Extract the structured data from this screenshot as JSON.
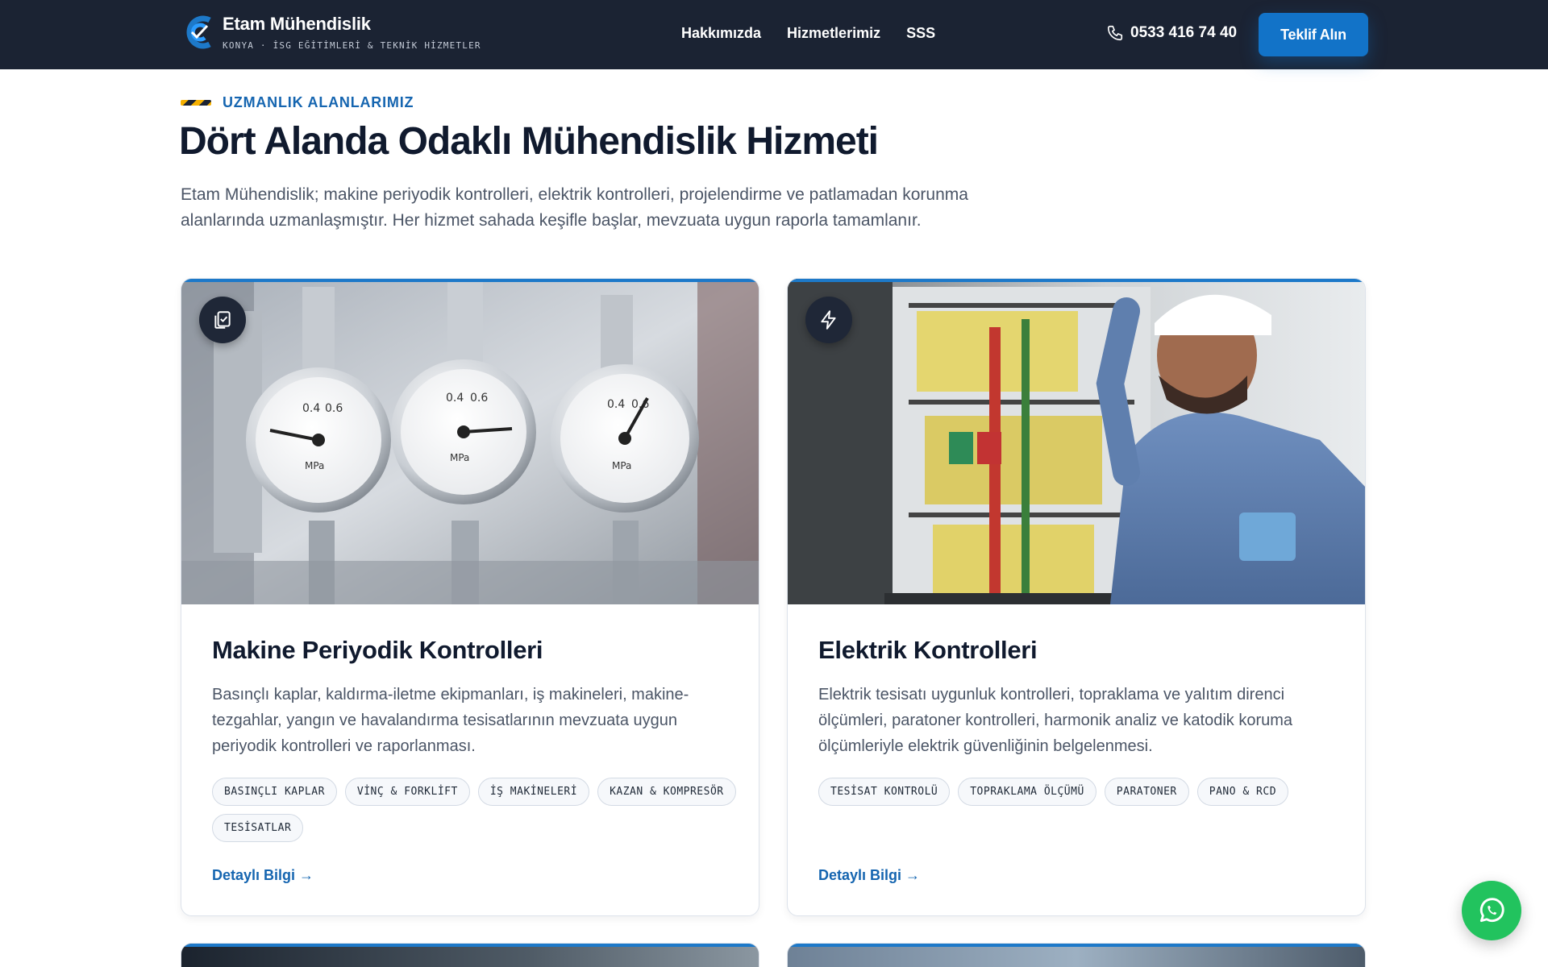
{
  "header": {
    "brand_name": "Etam Mühendislik",
    "brand_sub": "KONYA · İSG EĞİTİMLERİ & TEKNİK HİZMETLER",
    "nav": [
      "Hakkımızda",
      "Hizmetlerimiz",
      "SSS"
    ],
    "phone": "0533 416 74 40",
    "cta": "Teklif Alın"
  },
  "section": {
    "eyebrow": "UZMANLIK ALANLARIMIZ",
    "title": "Dört Alanda Odaklı Mühendislik Hizmeti",
    "lead": "Etam Mühendislik; makine periyodik kontrolleri, elektrik kontrolleri, projelendirme ve patlamadan korunma alanlarında uzmanlaşmıştır. Her hizmet sahada keşifle başlar, mevzuata uygun raporla tamamlanır."
  },
  "cards": [
    {
      "icon": "clipboard-check-icon",
      "title": "Makine Periyodik Kontrolleri",
      "desc": "Basınçlı kaplar, kaldırma-iletme ekipmanları, iş makineleri, makine-tezgahlar, yangın ve havalandırma tesisatlarının mevzuata uygun periyodik kontrolleri ve raporlanması.",
      "tags": [
        "BASINÇLI KAPLAR",
        "VİNÇ & FORKLİFT",
        "İŞ MAKİNELERİ",
        "KAZAN & KOMPRESÖR",
        "TESİSATLAR"
      ],
      "link": "Detaylı Bilgi →"
    },
    {
      "icon": "lightning-icon",
      "title": "Elektrik Kontrolleri",
      "desc": "Elektrik tesisatı uygunluk kontrolleri, topraklama ve yalıtım direnci ölçümleri, paratoner kontrolleri, harmonik analiz ve katodik koruma ölçümleriyle elektrik güvenliğinin belgelenmesi.",
      "tags": [
        "TESİSAT KONTROLÜ",
        "TOPRAKLAMA ÖLÇÜMÜ",
        "PARATONER",
        "PANO & RCD"
      ],
      "link": "Detaylı Bilgi →"
    }
  ],
  "colors": {
    "header_bg": "#1b2333",
    "accent": "#1273c8",
    "whatsapp": "#22c35e"
  }
}
